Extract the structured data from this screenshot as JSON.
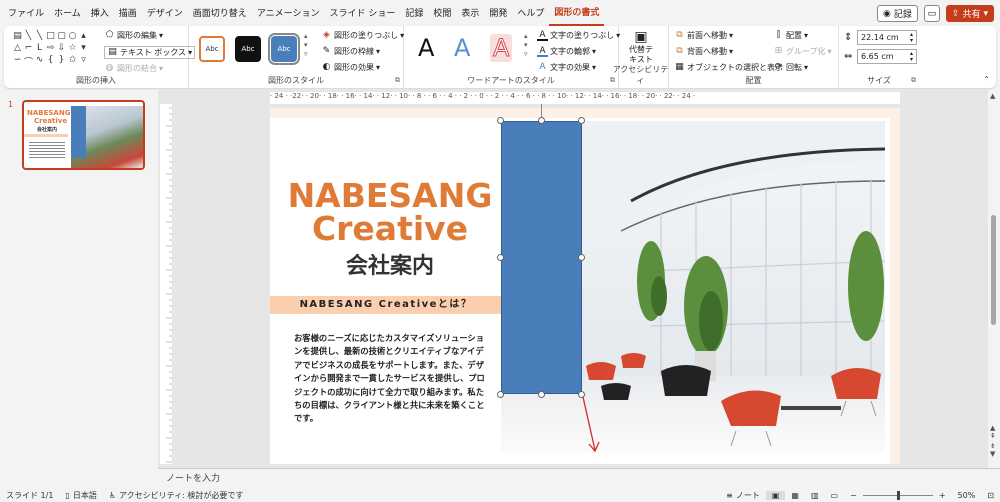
{
  "menu": {
    "items": [
      "ファイル",
      "ホーム",
      "挿入",
      "描画",
      "デザイン",
      "画面切り替え",
      "アニメーション",
      "スライド ショー",
      "記録",
      "校閲",
      "表示",
      "開発",
      "ヘルプ",
      "図形の書式"
    ],
    "record_label": "記録",
    "share_label": "共有"
  },
  "ribbon": {
    "insert_shapes": {
      "label": "図形の挿入",
      "edit_shape": "図形の編集",
      "text_box": "テキスト ボックス",
      "merge_shapes": "図形の結合"
    },
    "shape_styles": {
      "label": "図形のスタイル",
      "style_text": "Abc",
      "fill": "図形の塗りつぶし",
      "outline": "図形の枠線",
      "effects": "図形の効果"
    },
    "wordart": {
      "label": "ワードアートのスタイル",
      "letter": "A",
      "text_fill": "文字の塗りつぶし",
      "text_outline": "文字の輪郭",
      "text_effects": "文字の効果"
    },
    "accessibility": {
      "label": "アクセシビリティ",
      "alt_text_line1": "代替テ",
      "alt_text_line2": "キスト"
    },
    "arrange": {
      "label": "配置",
      "bring_forward": "前面へ移動",
      "send_backward": "背面へ移動",
      "selection_pane": "オブジェクトの選択と表示",
      "align": "配置",
      "group": "グループ化",
      "rotate": "回転"
    },
    "size": {
      "label": "サイズ",
      "height": "22.14 cm",
      "width": "6.65 cm"
    }
  },
  "slides_panel": {
    "slide_number": "1"
  },
  "ruler": {
    "horizontal": "· 24 · ·22· · 20· · 18· · 16· · 14· · 12· · 10· · 8 · · 6 · · 4 · · 2 · · 0 · · 2 · · 4 · · 6 · · 8 · · 10· · 12· · 14· · 16· · 18· · 20· · 22· · 24 ·"
  },
  "slide": {
    "title_line1": "NABESANG",
    "title_line2": "Creative",
    "subtitle": "会社案内",
    "banner": "NABESANG Creativeとは？",
    "body": "お客様のニーズに応じたカスタマイズソリューションを提供し、最新の技術とクリエイティブなアイデアでビジネスの成長をサポートします。また、デザインから開発まで一貫したサービスを提供し、プロジェクトの成功に向けて全力で取り組みます。私たちの目標は、クライアント様と共に未来を築くことです。"
  },
  "notes": {
    "placeholder": "ノートを入力"
  },
  "status": {
    "slide_info": "スライド 1/1",
    "language": "日本語",
    "accessibility": "アクセシビリティ: 検討が必要です",
    "notes_label": "ノート",
    "zoom": "50%"
  },
  "colors": {
    "accent": "#c43e1c",
    "brand_orange": "#e07a37",
    "shape_blue": "#4a7ebb",
    "banner_peach": "#fbcfae"
  }
}
